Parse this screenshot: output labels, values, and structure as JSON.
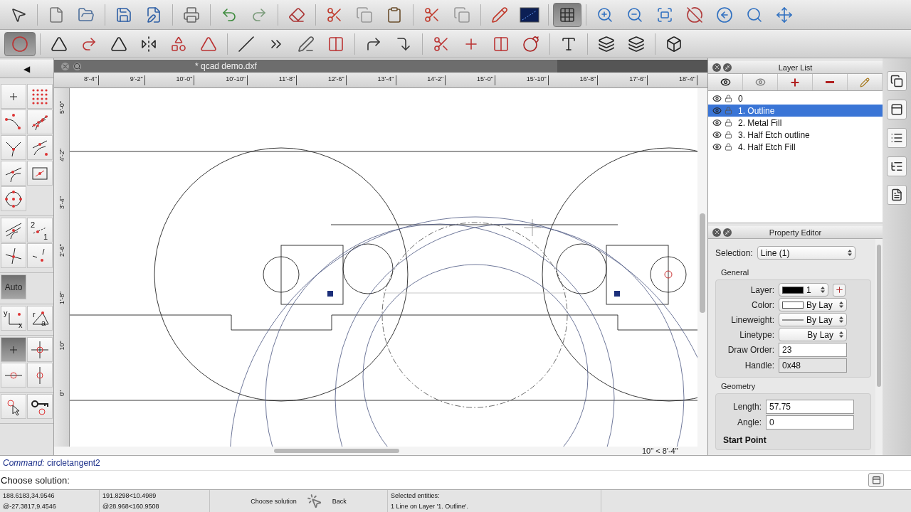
{
  "toolbars": {
    "row_1": [
      {
        "pressed": false
      },
      {
        "pressed": false
      },
      {
        "pressed": false
      },
      {
        "pressed": false
      },
      {
        "pressed": false
      },
      {
        "pressed": false
      },
      {
        "pressed": false
      },
      {
        "pressed": false
      },
      {
        "pressed": false
      },
      {
        "pressed": false
      },
      {
        "pressed": false
      },
      {
        "pressed": false
      },
      {
        "pressed": false
      },
      {
        "pressed": false
      },
      {
        "pressed": false
      },
      {
        "pressed": false
      },
      {
        "pressed": true
      },
      {
        "pressed": false
      },
      {
        "pressed": false
      },
      {
        "pressed": false
      },
      {
        "pressed": false
      },
      {
        "pressed": false
      },
      {
        "pressed": false
      },
      {
        "pressed": false
      }
    ],
    "row_2": [
      {
        "pressed": true
      },
      {
        "pressed": false
      },
      {
        "pressed": false
      },
      {
        "pressed": false
      },
      {
        "pressed": false
      },
      {
        "pressed": false
      },
      {
        "pressed": false
      },
      {
        "pressed": false
      },
      {
        "pressed": false
      },
      {
        "pressed": false
      },
      {
        "pressed": false
      },
      {
        "pressed": false
      },
      {
        "pressed": false
      },
      {
        "pressed": false
      },
      {
        "pressed": false
      },
      {
        "pressed": false
      },
      {
        "pressed": false
      },
      {
        "pressed": false
      },
      {
        "pressed": false
      },
      {
        "pressed": false
      },
      {
        "pressed": false
      }
    ]
  },
  "left_toolbar": {
    "collapse": "◀",
    "groups": [
      [
        {
          "kind": "icon",
          "pressed": false
        },
        {
          "kind": "icon",
          "pressed": false
        },
        {
          "kind": "icon",
          "pressed": false
        },
        {
          "kind": "icon",
          "pressed": false
        },
        {
          "kind": "icon",
          "pressed": false
        },
        {
          "kind": "icon",
          "pressed": false
        },
        {
          "kind": "icon",
          "pressed": false
        },
        {
          "kind": "icon",
          "pressed": false
        },
        {
          "kind": "icon",
          "pressed": false
        },
        {
          "kind": "empty"
        }
      ],
      [
        {
          "kind": "icon",
          "pressed": false
        },
        {
          "kind": "letters",
          "letters": [
            "2",
            "1"
          ],
          "pressed": false
        },
        {
          "kind": "icon",
          "pressed": false
        },
        {
          "kind": "icon",
          "pressed": false
        }
      ],
      [
        {
          "kind": "text",
          "label": "Auto",
          "pressed": true
        },
        {
          "kind": "empty"
        }
      ],
      [
        {
          "kind": "letters",
          "letters": [
            "y",
            "x"
          ],
          "pressed": false
        },
        {
          "kind": "letters",
          "letters": [
            "r",
            "a"
          ],
          "pressed": false
        }
      ],
      [
        {
          "kind": "icon",
          "pressed": true
        },
        {
          "kind": "icon",
          "pressed": false
        },
        {
          "kind": "icon",
          "pressed": false
        },
        {
          "kind": "icon",
          "pressed": false
        }
      ],
      [
        {
          "kind": "icon",
          "pressed": false
        },
        {
          "kind": "icon",
          "pressed": false
        }
      ]
    ]
  },
  "drawing": {
    "tab_title": "* qcad demo.dxf",
    "ruler_x": [
      "8'-4\"",
      "9'-2\"",
      "10'-0\"",
      "10'-10\"",
      "11'-8\"",
      "12'-6\"",
      "13'-4\"",
      "14'-2\"",
      "15'-0\"",
      "15'-10\"",
      "16'-8\"",
      "17'-6\"",
      "18'-4\""
    ],
    "ruler_y": [
      "5'-0\"",
      "4'-2\"",
      "3'-4\"",
      "2'-6\"",
      "1'-8\"",
      "10\"",
      "0\""
    ],
    "zoom_readout": "10\" < 8'-4\""
  },
  "layer_list": {
    "title": "Layer List",
    "layers": [
      {
        "name": "0",
        "selected": false
      },
      {
        "name": "1. Outline",
        "selected": true
      },
      {
        "name": "2. Metal Fill",
        "selected": false
      },
      {
        "name": "3. Half Etch outline",
        "selected": false
      },
      {
        "name": "4. Half Etch Fill",
        "selected": false
      }
    ]
  },
  "property_editor": {
    "title": "Property Editor",
    "selection_label": "Selection:",
    "selection": "Line (1)",
    "general": {
      "title": "General",
      "rows": [
        {
          "kind": "layer",
          "label": "Layer:",
          "value": "1"
        },
        {
          "kind": "color",
          "label": "Color:",
          "value": "By Lay"
        },
        {
          "kind": "lineweight",
          "label": "Lineweight:",
          "value": "By Lay"
        },
        {
          "kind": "linetype",
          "label": "Linetype:",
          "value": "By Lay"
        },
        {
          "kind": "input",
          "label": "Draw Order:",
          "value": "23"
        },
        {
          "kind": "readonly",
          "label": "Handle:",
          "value": "0x48"
        }
      ]
    },
    "geometry": {
      "title": "Geometry",
      "rows": [
        {
          "kind": "input",
          "label": "Length:",
          "value": "57.75"
        },
        {
          "kind": "input",
          "label": "Angle:",
          "value": "0"
        }
      ],
      "subheading": "Start Point"
    }
  },
  "command": {
    "history_label": "Command:",
    "history_text": "circletangent2",
    "prompt": "Choose solution:"
  },
  "status_bar": {
    "absolute": "188.6183,34.9546",
    "relative": "@-27.3817,9.4546",
    "polar": "191.8298<10.4989",
    "relative_polar": "@28.968<160.9508",
    "left_button": "Choose solution",
    "right_button": "Back",
    "selection_title": "Selected entities:",
    "selection_text": "1 Line on Layer '1. Outline'."
  }
}
